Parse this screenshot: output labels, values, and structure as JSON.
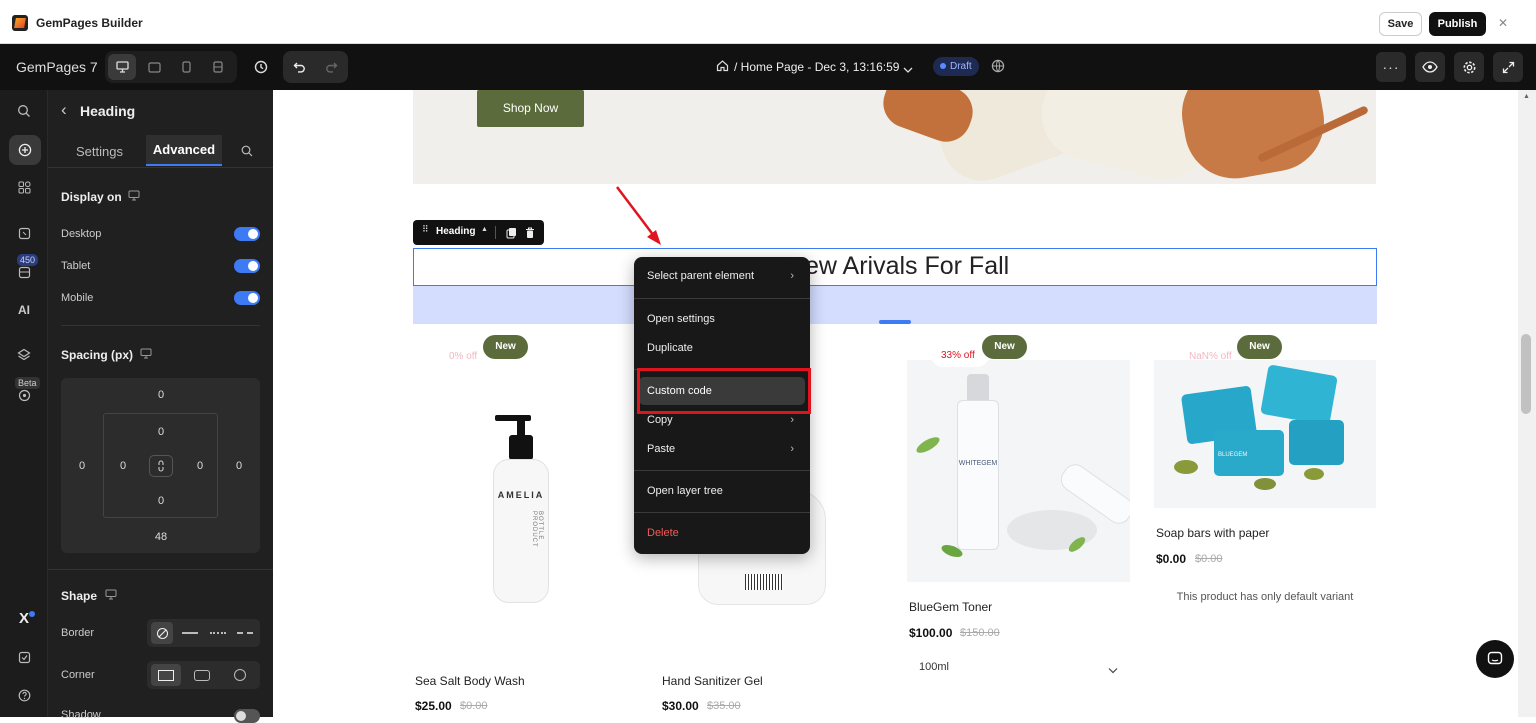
{
  "app": {
    "title": "GemPages Builder",
    "save": "Save",
    "publish": "Publish",
    "close": "✕"
  },
  "topbar": {
    "brand": "GemPages 7",
    "page_title": "/ Home Page - Dec 3, 13:16:59",
    "status": "Draft"
  },
  "rail": {
    "count_badge": "450",
    "ai": "AI",
    "beta": "Beta"
  },
  "panel": {
    "back": "‹",
    "title": "Heading",
    "tabs": [
      "Settings",
      "Advanced"
    ],
    "display_on": {
      "label": "Display on",
      "items": [
        {
          "label": "Desktop",
          "on": true
        },
        {
          "label": "Tablet",
          "on": true
        },
        {
          "label": "Mobile",
          "on": true
        }
      ]
    },
    "spacing": {
      "label": "Spacing (px)",
      "margin_top": "0",
      "margin_left": "0",
      "margin_right": "0",
      "margin_bottom": "48",
      "padding_top": "0",
      "padding_left": "0",
      "padding_right": "0",
      "padding_bottom": "0"
    },
    "shape": {
      "label": "Shape",
      "border": "Border",
      "corner": "Corner",
      "shadow": "Shadow"
    }
  },
  "canvas": {
    "hero_button": "Shop Now",
    "heading_toolbar": "Heading",
    "heading_text": "ew Arivals For Fall",
    "products": [
      {
        "discount": "0% off",
        "badge": "New",
        "name": "Sea Salt Body Wash",
        "price": "$25.00",
        "compare": "$0.00"
      },
      {
        "discount": "",
        "badge": "",
        "name": "Hand Sanitizer Gel",
        "price": "$30.00",
        "compare": "$35.00"
      },
      {
        "discount": "33% off",
        "badge": "New",
        "name": "BlueGem Toner",
        "price": "$100.00",
        "compare": "$150.00",
        "variant": "100ml"
      },
      {
        "discount": "NaN% off",
        "badge": "New",
        "name": "Soap bars with paper",
        "price": "$0.00",
        "compare": "$0.00",
        "note": "This product has only default variant"
      }
    ],
    "bottle_labels": {
      "brand": "AMELIA",
      "sub": "BOTTLE PRODUCT",
      "toner": "WHITEGEM",
      "soap": "BLUEGEM"
    }
  },
  "context_menu": {
    "items": [
      {
        "label": "Select parent element",
        "submenu": true
      },
      {
        "label": "Open settings",
        "submenu": false
      },
      {
        "label": "Duplicate",
        "submenu": false
      },
      {
        "label": "Custom code",
        "submenu": false
      },
      {
        "label": "Copy",
        "submenu": true
      },
      {
        "label": "Paste",
        "submenu": true
      },
      {
        "label": "Open layer tree",
        "submenu": false
      },
      {
        "label": "Delete",
        "submenu": false
      }
    ]
  },
  "colors": {
    "accent": "#3d7bf5",
    "badge_green": "#5c6b3b",
    "highlight_red": "#e0141e",
    "delete_red": "#f05a5a"
  }
}
